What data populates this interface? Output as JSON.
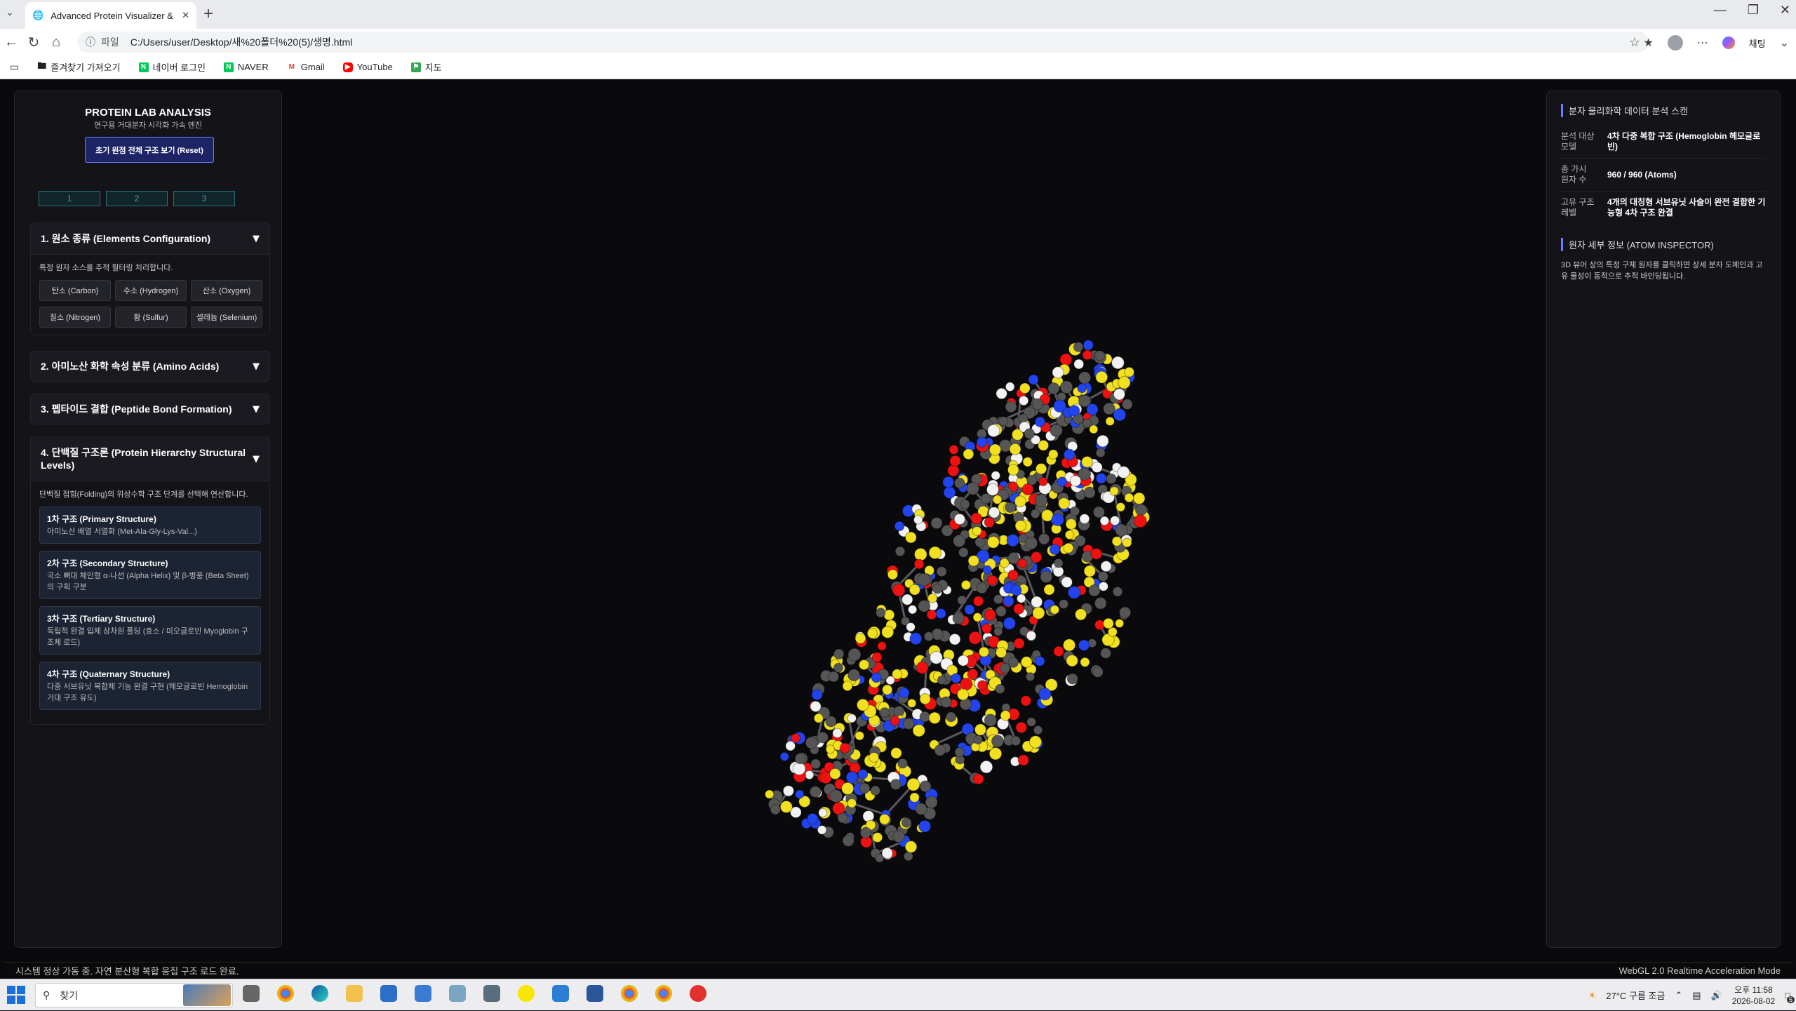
{
  "browser": {
    "tab_title": "Advanced Protein Visualizer & Stru",
    "address_scheme": "파일",
    "address_url": "C:/Users/user/Desktop/새%20폴더%20(5)/생명.html",
    "copilot_label": "채팅",
    "bookmarks": [
      {
        "label": "즐겨찾기 가져오기",
        "icon": "folder-icon"
      },
      {
        "label": "네이버 로그인",
        "icon": "naver-icon",
        "color": "#03c75a"
      },
      {
        "label": "NAVER",
        "icon": "naver-icon",
        "color": "#03c75a"
      },
      {
        "label": "Gmail",
        "icon": "gmail-icon",
        "color": "#ea4335"
      },
      {
        "label": "YouTube",
        "icon": "youtube-icon",
        "color": "#ff0000"
      },
      {
        "label": "지도",
        "icon": "map-icon",
        "color": "#34a853"
      }
    ]
  },
  "left": {
    "title": "PROTEIN LAB ANALYSIS",
    "subtitle": "연구용 거대분자 시각화 가속 엔진",
    "reset_label": "초기 원점 전체 구조 보기 (Reset)",
    "presets": [
      "1",
      "2",
      "3"
    ],
    "sections": {
      "elements": {
        "title": "1. 원소 종류 (Elements Configuration)",
        "desc": "특정 원자 소스를 추적 필터링 처리합니다.",
        "buttons": [
          "탄소 (Carbon)",
          "수소 (Hydrogen)",
          "산소 (Oxygen)",
          "질소 (Nitrogen)",
          "황 (Sulfur)",
          "셀레늄 (Selenium)"
        ]
      },
      "amino": {
        "title": "2. 아미노산 화학 속성 분류 (Amino Acids)"
      },
      "peptide": {
        "title": "3. 펩타이드 결합 (Peptide Bond Formation)"
      },
      "hierarchy": {
        "title": "4. 단백질 구조론 (Protein Hierarchy Structural Levels)",
        "desc": "단백질 접힘(Folding)의 위상수학 구조 단계를 선택해 연산합니다.",
        "levels": [
          {
            "title": "1차 구조 (Primary Structure)",
            "desc": "아미노산 배열 서열화 (Met-Ala-Gly-Lys-Val...)"
          },
          {
            "title": "2차 구조 (Secondary Structure)",
            "desc": "국소 뼈대 체인형 α-나선 (Alpha Helix) 및 β-병풍 (Beta Sheet)의 구획 구분"
          },
          {
            "title": "3차 구조 (Tertiary Structure)",
            "desc": "독립적 완결 입체 삼차원 폴딩 (효소 / 미오글로빈 Myoglobin 구조체 로드)"
          },
          {
            "title": "4차 구조 (Quaternary Structure)",
            "desc": "다중 서브유닛 복합체 기능 완결 구현 (헤모글로빈 Hemoglobin 거대 구조 유도)"
          }
        ]
      }
    }
  },
  "right": {
    "scan_title": "분자 물리화학 데이터 분석 스캔",
    "rows": [
      {
        "key": "분석 대상 모델",
        "value": "4차 다중 복합 구조 (Hemoglobin 헤모글로빈)"
      },
      {
        "key": "총 가시 원자 수",
        "value": "960 / 960 (Atoms)"
      },
      {
        "key": "고유 구조 레벨",
        "value": "4개의 대칭형 서브유닛 사슬이 완전 결합한 기능형 4차 구조 완결"
      }
    ],
    "inspector_title": "원자 세부 정보 (ATOM INSPECTOR)",
    "inspector_text": "3D 뷰어 상의 특정 구체 원자를 클릭하면 상세 분자 도메인과 고유 물성이 동적으로 추적 바인딩됩니다."
  },
  "status": {
    "left": "시스템 정상 가동 중. 자연 분산형 복합 응집 구조 로드 완료.",
    "right": "WebGL 2.0 Realtime Acceleration Mode"
  },
  "atom_colors": {
    "carbon": "#555555",
    "oxygen": "#ee1111",
    "nitrogen": "#2244ee",
    "sulfur": "#f0e020",
    "hydrogen": "#f2f2f2",
    "bond": "#5a5a5e"
  },
  "taskbar": {
    "search_placeholder": "찾기",
    "weather": "27°C 구름 조금",
    "time": "오후 11:58",
    "date": "2026-08-02",
    "notification_count": "5"
  }
}
